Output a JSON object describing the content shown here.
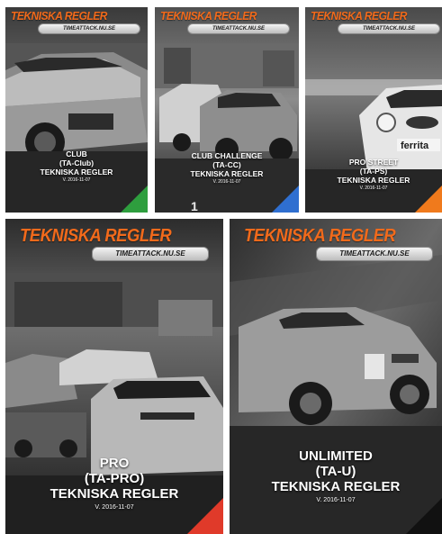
{
  "cards": [
    {
      "brand": "TEKNISKA REGLER",
      "site": "TIMEATTACK.NU.SE",
      "line1": "CLUB",
      "line2": "(TA-Club)",
      "line3": "TEKNISKA REGLER",
      "version": "V. 2016-11-07",
      "accent": "#2e9e3e"
    },
    {
      "brand": "TEKNISKA REGLER",
      "site": "TIMEATTACK.NU.SE",
      "line1": "CLUB CHALLENGE",
      "line2": "(TA-CC)",
      "line3": "TEKNISKA REGLER",
      "version": "V. 2016-11-07",
      "accent": "#2f6fd0"
    },
    {
      "brand": "TEKNISKA REGLER",
      "site": "TIMEATTACK.NU.SE",
      "line1": "PRO STREET",
      "line2": "(TA-PS)",
      "line3": "TEKNISKA REGLER",
      "version": "V. 2016-11-07",
      "accent": "#f07a1c"
    },
    {
      "brand": "TEKNISKA REGLER",
      "site": "TIMEATTACK.NU.SE",
      "line1": "PRO",
      "line2": "(TA-PRO)",
      "line3": "TEKNISKA REGLER",
      "version": "V. 2016-11-07",
      "accent": "#e03a2a"
    },
    {
      "brand": "TEKNISKA REGLER",
      "site": "TIMEATTACK.NU.SE",
      "line1": "UNLIMITED",
      "line2": "(TA-U)",
      "line3": "TEKNISKA REGLER",
      "version": "V. 2016-11-07",
      "accent": "#111111"
    }
  ],
  "photo_text": {
    "ferrita": "ferrita",
    "number": "1"
  }
}
